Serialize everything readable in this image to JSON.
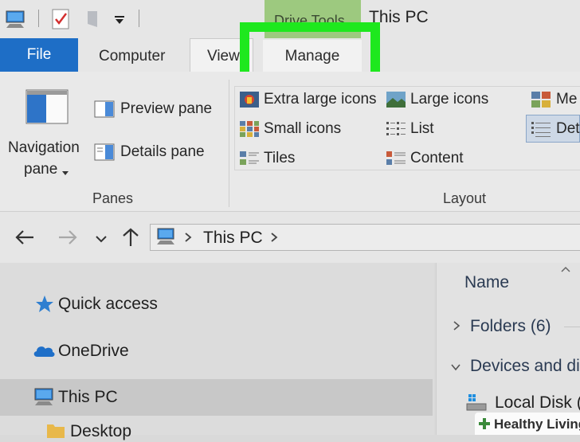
{
  "window": {
    "title": "This PC",
    "context_tab_group": "Drive Tools"
  },
  "ribbon_tabs": {
    "file": "File",
    "computer": "Computer",
    "view": "View",
    "manage": "Manage"
  },
  "ribbon": {
    "panes_group": {
      "navigation_pane_line1": "Navigation",
      "navigation_pane_line2": "pane",
      "preview_pane": "Preview pane",
      "details_pane": "Details pane",
      "label": "Panes"
    },
    "layout_group": {
      "extra_large_icons": "Extra large icons",
      "large_icons": "Large icons",
      "medium_icons": "Me",
      "small_icons": "Small icons",
      "list": "List",
      "details": "Det",
      "tiles": "Tiles",
      "content": "Content",
      "label": "Layout"
    }
  },
  "address": {
    "location": "This PC"
  },
  "nav_pane": {
    "items": [
      "Quick access",
      "OneDrive",
      "This PC",
      "Desktop"
    ],
    "selected": "This PC"
  },
  "content_pane": {
    "column_header": "Name",
    "groups": [
      "Folders (6)",
      "Devices and di"
    ],
    "items": [
      "Local Disk ("
    ]
  },
  "watermark": "Healthy Living",
  "colors": {
    "file_tab": "#1e6ec6",
    "highlight": "#1ee81e",
    "context_tab": "#9dc97f"
  }
}
